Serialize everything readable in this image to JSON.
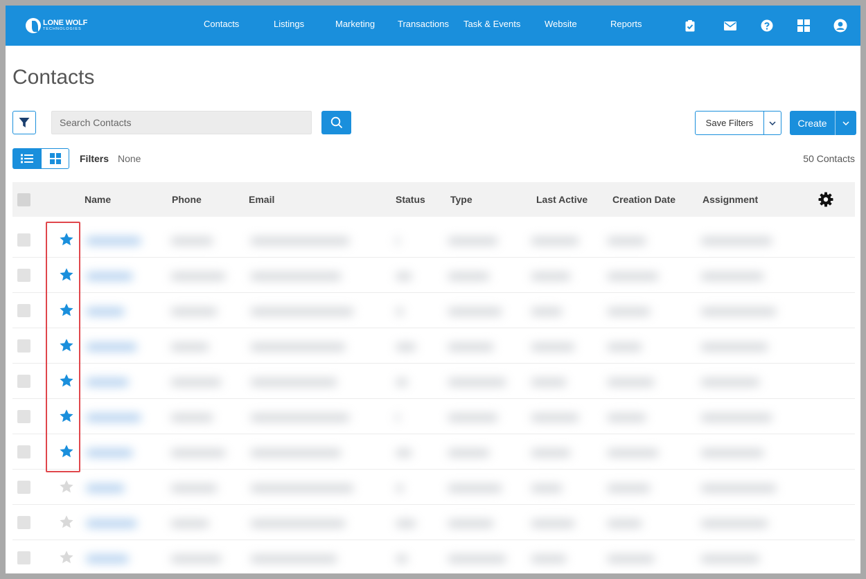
{
  "app": {
    "brand_line1": "LONE WOLF",
    "brand_line2": "TECHNOLOGIES"
  },
  "nav": {
    "links": [
      "Contacts",
      "Listings",
      "Marketing",
      "Transactions",
      "Task & Events",
      "Website",
      "Reports"
    ],
    "icons": [
      "clipboard-check-icon",
      "envelope-icon",
      "help-icon",
      "apps-grid-icon",
      "user-account-icon"
    ]
  },
  "page": {
    "title": "Contacts"
  },
  "toolbar": {
    "search_placeholder": "Search Contacts",
    "save_filters_label": "Save Filters",
    "create_label": "Create"
  },
  "filters": {
    "label": "Filters",
    "value": "None",
    "count": "50 Contacts"
  },
  "table": {
    "columns": [
      "Name",
      "Phone",
      "Email",
      "Status",
      "Type",
      "Last Active",
      "Creation Date",
      "Assignment"
    ],
    "rows": [
      {
        "starred": true
      },
      {
        "starred": true
      },
      {
        "starred": true
      },
      {
        "starred": true
      },
      {
        "starred": true
      },
      {
        "starred": true
      },
      {
        "starred": true
      },
      {
        "starred": false
      },
      {
        "starred": false
      },
      {
        "starred": false
      }
    ]
  },
  "colors": {
    "brand": "#1a8fdc",
    "star_active": "#1a8fdc",
    "star_inactive": "#d9d9d9",
    "highlight": "#e0464b"
  }
}
